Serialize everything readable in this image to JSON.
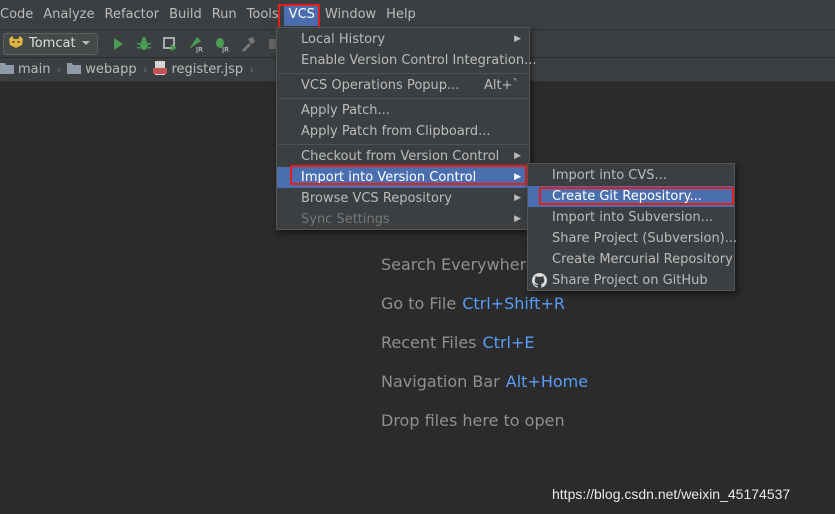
{
  "menubar": {
    "items": [
      "Code",
      "Analyze",
      "Refactor",
      "Build",
      "Run",
      "Tools",
      "VCS",
      "Window",
      "Help"
    ]
  },
  "toolbar": {
    "run_config": "Tomcat"
  },
  "breadcrumb": {
    "items": [
      "main",
      "webapp",
      "register.jsp"
    ]
  },
  "vcs_menu": {
    "items": [
      {
        "label": "Local History"
      },
      {
        "label": "Enable Version Control Integration..."
      },
      {
        "label": "VCS Operations Popup...",
        "shortcut": "Alt+`"
      },
      {
        "label": "Apply Patch..."
      },
      {
        "label": "Apply Patch from Clipboard..."
      },
      {
        "label": "Checkout from Version Control"
      },
      {
        "label": "Import into Version Control"
      },
      {
        "label": "Browse VCS Repository"
      },
      {
        "label": "Sync Settings"
      }
    ]
  },
  "import_submenu": {
    "items": [
      {
        "label": "Import into CVS..."
      },
      {
        "label": "Create Git Repository..."
      },
      {
        "label": "Import into Subversion..."
      },
      {
        "label": "Share Project (Subversion)..."
      },
      {
        "label": "Create Mercurial Repository"
      },
      {
        "label": "Share Project on GitHub"
      }
    ]
  },
  "hints": {
    "search": {
      "label": "Search Everywhere"
    },
    "goto_file": {
      "label": "Go to File",
      "key": "Ctrl+Shift+R"
    },
    "recent": {
      "label": "Recent Files",
      "key": "Ctrl+E"
    },
    "navbar": {
      "label": "Navigation Bar",
      "key": "Alt+Home"
    },
    "drop": {
      "label": "Drop files here to open"
    }
  },
  "watermark": "https://blog.csdn.net/weixin_45174537",
  "colors": {
    "background": "#2b2b2b",
    "panel": "#3c3f41",
    "selection": "#4b6eaf",
    "shortcut_key": "#589df6",
    "highlight_box": "#e0201e"
  }
}
